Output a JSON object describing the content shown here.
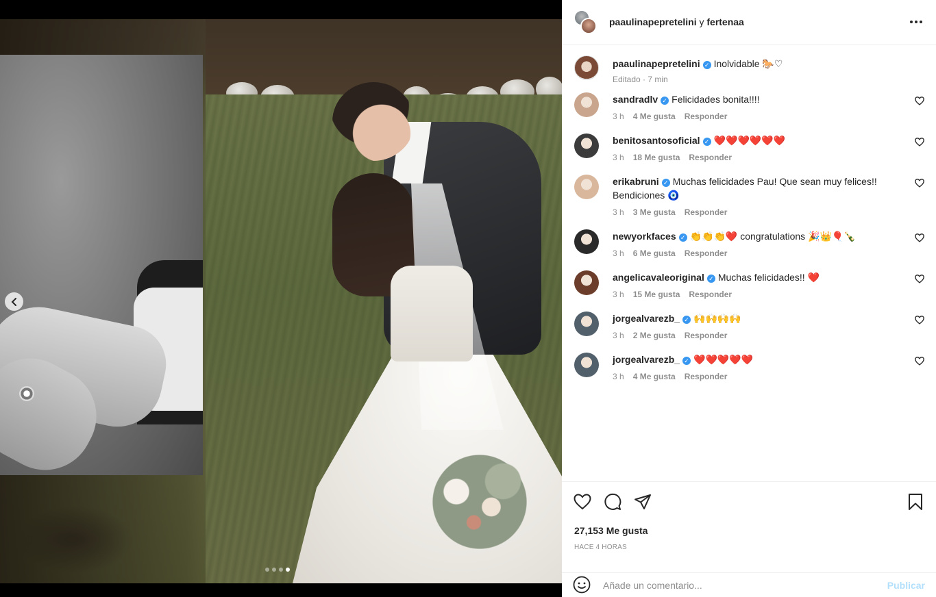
{
  "header": {
    "user1": "paaulinapepretelini",
    "connector": "y",
    "user2": "fertenaa"
  },
  "caption": {
    "user": "paaulinapepretelini",
    "text": "Inolvidable 🐎♡",
    "meta": "Editado · 7 min"
  },
  "comments": [
    {
      "user": "sandradlv",
      "verified": true,
      "text": "Felicidades bonita!!!!",
      "time": "3 h",
      "likes": "4 Me gusta",
      "reply": "Responder",
      "avatar_color": "#c8a58c"
    },
    {
      "user": "benitosantosoficial",
      "verified": true,
      "text": "❤️❤️❤️❤️❤️❤️",
      "time": "3 h",
      "likes": "18 Me gusta",
      "reply": "Responder",
      "avatar_color": "#3b3b3b"
    },
    {
      "user": "erikabruni",
      "verified": true,
      "text": "Muchas felicidades Pau! Que sean muy felices!! Bendiciones 🧿",
      "time": "3 h",
      "likes": "3 Me gusta",
      "reply": "Responder",
      "avatar_color": "#d9b79c"
    },
    {
      "user": "newyorkfaces",
      "verified": true,
      "text": "👏👏👏❤️ congratulations 🎉👑🎈🍾",
      "time": "3 h",
      "likes": "6 Me gusta",
      "reply": "Responder",
      "avatar_color": "#2a2a2a"
    },
    {
      "user": "angelicavaleoriginal",
      "verified": true,
      "text": "Muchas felicidades!! ❤️",
      "time": "3 h",
      "likes": "15 Me gusta",
      "reply": "Responder",
      "avatar_color": "#6b3d2a"
    },
    {
      "user": "jorgealvarezb_",
      "verified": true,
      "text": "🙌🙌🙌🙌",
      "time": "3 h",
      "likes": "2 Me gusta",
      "reply": "Responder",
      "avatar_color": "#52606b"
    },
    {
      "user": "jorgealvarezb_",
      "verified": true,
      "text": "❤️❤️❤️❤️❤️",
      "time": "3 h",
      "likes": "4 Me gusta",
      "reply": "Responder",
      "avatar_color": "#52606b"
    }
  ],
  "actions": {
    "like_icon": "heart-outline-icon",
    "comment_icon": "comment-bubble-icon",
    "share_icon": "paper-plane-icon",
    "save_icon": "bookmark-icon"
  },
  "likes": "27,153 Me gusta",
  "timestamp": "HACE 4 HORAS",
  "comment_box": {
    "placeholder": "Añade un comentario...",
    "publish": "Publicar"
  },
  "carousel": {
    "total": 4,
    "active": 4
  },
  "colors": {
    "verified": "#3897f0",
    "publish_disabled": "#b2dffc",
    "muted": "#8e8e8e"
  }
}
